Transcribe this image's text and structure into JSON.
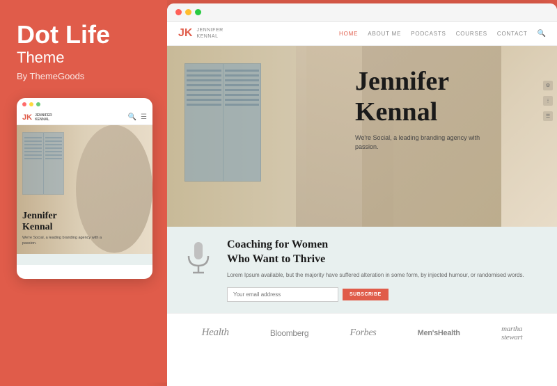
{
  "brand": {
    "title": "Dot Life",
    "subtitle": "Theme",
    "byline": "By ThemeGoods"
  },
  "mobile_mockup": {
    "dots": [
      "red",
      "yellow",
      "green"
    ],
    "logo_jk": "JK",
    "logo_name": "JENNIFER\nKENNAL",
    "hero_name_line1": "Jennifer",
    "hero_name_line2": "Kennal",
    "hero_desc": "We're Social, a leading branding agency with a passion."
  },
  "desktop_mockup": {
    "dots": [
      "red",
      "yellow",
      "green"
    ],
    "logo_jk": "JK",
    "logo_name_line1": "JENNIFER",
    "logo_name_line2": "KENNAL",
    "nav_links": [
      {
        "label": "HOME",
        "active": true
      },
      {
        "label": "ABOUT ME",
        "active": false
      },
      {
        "label": "PODCASTS",
        "active": false
      },
      {
        "label": "COURSES",
        "active": false
      },
      {
        "label": "CONTACT",
        "active": false
      }
    ],
    "hero": {
      "name_line1": "Jennifer",
      "name_line2": "Kennal",
      "tagline": "We're Social, a leading branding agency with passion."
    },
    "coaching": {
      "title_line1": "Coaching for Women",
      "title_line2": "Who Want to Thrive",
      "description": "Lorem Ipsum available, but the majority have suffered alteration in some form, by injected humour, or randomised words.",
      "email_placeholder": "Your email address",
      "subscribe_label": "SUBSCRIBE"
    },
    "brands": [
      {
        "label": "Health",
        "class": "health"
      },
      {
        "label": "Bloomberg",
        "class": "bloomberg"
      },
      {
        "label": "Forbes",
        "class": "forbes"
      },
      {
        "label": "Men'sHealth",
        "class": "mens-health"
      },
      {
        "label": "martha\nstewart",
        "class": "martha"
      }
    ]
  }
}
